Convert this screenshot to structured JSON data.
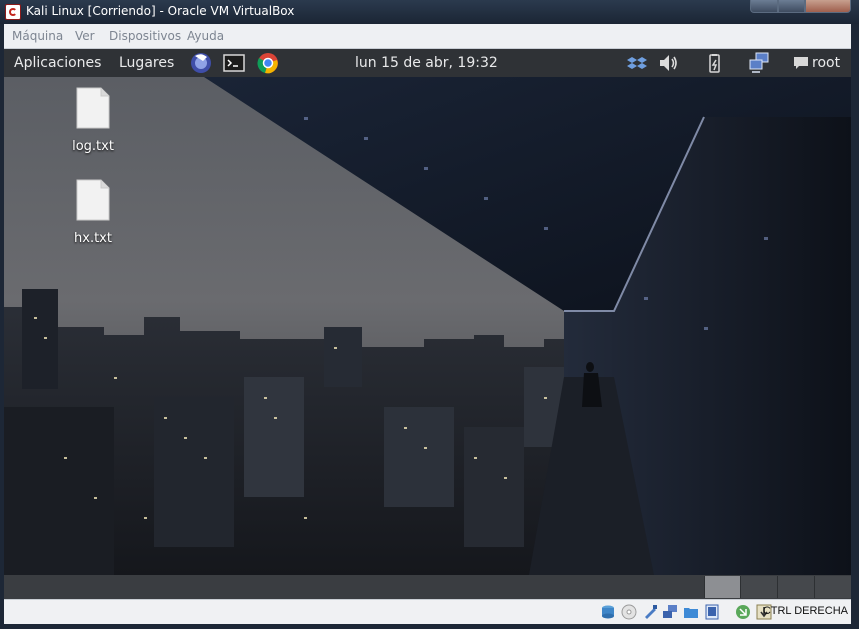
{
  "window": {
    "title": "Kali Linux [Corriendo] - Oracle VM VirtualBox"
  },
  "vbox_menu": [
    "Máquina",
    "Ver",
    "Dispositivos",
    "Ayuda"
  ],
  "panel": {
    "applications": "Aplicaciones",
    "places": "Lugares",
    "clock": "lun 15 de abr, 19:32",
    "user": "root"
  },
  "desktop_icons": [
    {
      "label": "log.txt"
    },
    {
      "label": "hx.txt"
    }
  ],
  "statusbar": {
    "host_key": "CTRL DERECHA"
  }
}
